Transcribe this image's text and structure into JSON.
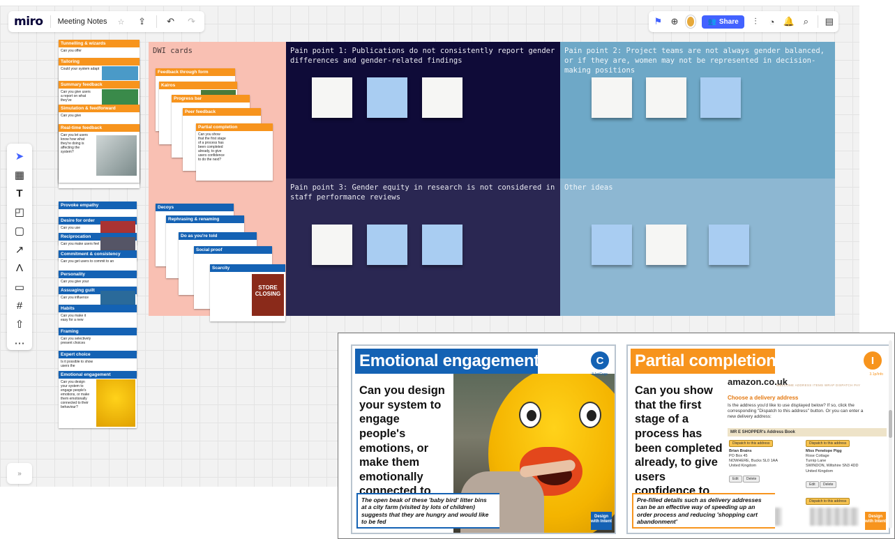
{
  "app": {
    "logo": "miro",
    "board_title": "Meeting Notes",
    "share_label": "Share"
  },
  "toolbar": {
    "tools": [
      "select",
      "templates",
      "text",
      "sticky-note",
      "shape",
      "connection-line",
      "pen",
      "comment",
      "frame",
      "upload",
      "more"
    ]
  },
  "left_stack_top": [
    "Tunnelling & wizards",
    "Tailoring",
    "Summary feedback",
    "Simulation & feedforward",
    "Real-time feedback"
  ],
  "left_stack_top_text": [
    "Can you offer",
    "Could your system adapt",
    "Can you give users a report on what they've",
    "Can you give",
    "Can you let users know how what they're doing is affecting the system?"
  ],
  "left_stack_bottom": [
    "Provoke empathy",
    "Desire for order",
    "Reciprocation",
    "Commitment & consistency",
    "Personality",
    "Assuaging guilt",
    "Habits",
    "Framing",
    "Expert choice",
    "Emotional engagement"
  ],
  "left_stack_bottom_text": [
    "Can you use",
    "Can you make users feel",
    "Can you get users to commit to an",
    "Can you give your",
    "Can you influence",
    "Can you make it easy for a new",
    "Can you selectively present choices",
    "Is it possible to show users the",
    "Can you design your system to engage people's emotions, or make them emotionally connected to their behaviour?"
  ],
  "dwi_frame": {
    "title": "DWI cards",
    "cards_a": [
      "Feedback through form",
      "Kairos",
      "Progress bar",
      "Peer feedback",
      "Partial completion"
    ],
    "cards_b": [
      "Decoys",
      "Rephrasing & renaming",
      "Do as you're told",
      "Social proof",
      "Scarcity"
    ],
    "scarcity_photo_text": [
      "STORE",
      "CLOSING"
    ]
  },
  "quadrants": [
    {
      "title": "Pain point 1: Publications do not consistently report gender differences and gender-related findings",
      "notes": [
        "white",
        "blue",
        "white"
      ]
    },
    {
      "title": "Pain point 2: Project teams are not always gender balanced, or if they are, women may not be represented in decision-making positions",
      "notes": [
        "white",
        "white",
        "blue"
      ]
    },
    {
      "title": "Pain point 3: Gender equity in research is not considered in staff performance reviews",
      "notes": [
        "white",
        "blue",
        "blue"
      ]
    },
    {
      "title": "Other ideas",
      "notes": [
        "blue",
        "white",
        "blue"
      ]
    }
  ],
  "zoom_cards": [
    {
      "title": "Emotional engagement",
      "badge": "C",
      "badge_sub": "3.1p/Cogs",
      "question": "Can you design your system to engage people's emotions, or make them emotionally connected to their behaviour?",
      "caption": "The open beak of these 'baby bird' litter bins at a city farm (visited by lots of children) suggests that they are hungry and would like to be fed",
      "tag": "Design with Intent",
      "accent": "#1462b4"
    },
    {
      "title": "Partial completion",
      "badge": "I",
      "badge_sub": "3.1p/Info",
      "question": "Can you show that the first stage of a process has been completed already, to give users confidence to do the next?",
      "caption": "Pre-filled details such as delivery addresses can be an effective way of speeding up an order process and reducing 'shopping cart abandonment'",
      "tag": "Design with Intent",
      "accent": "#f7941d"
    }
  ],
  "amazon": {
    "logo": "amazon.co.uk",
    "tabs": "WELCOME   ADDRESS   ITEMS   WRAP   DISPATCH   PAY",
    "heading": "Choose a delivery address",
    "para": "Is the address you'd like to use displayed below? If so, click the corresponding \"Dispatch to this address\" button. Or you can enter a new delivery address:",
    "book": "MR E SHOPPER's Address Book",
    "dispatch": "Dispatch to this address",
    "addr1": [
      "Brian Brains",
      "PO Box 45",
      "NOWHERE, Bucks SL0 1AA",
      "United Kingdom"
    ],
    "addr2": [
      "Miss Penelope Pigg",
      "Rose Cottage",
      "Turnip Lane",
      "SWINDON, Wiltshire SN3 4DD",
      "United Kingdom"
    ],
    "edit": "Edit",
    "delete": "Delete"
  },
  "colors": {
    "brand_blue": "#4262ff",
    "card_orange": "#f7941d",
    "card_blue": "#1462b4"
  }
}
